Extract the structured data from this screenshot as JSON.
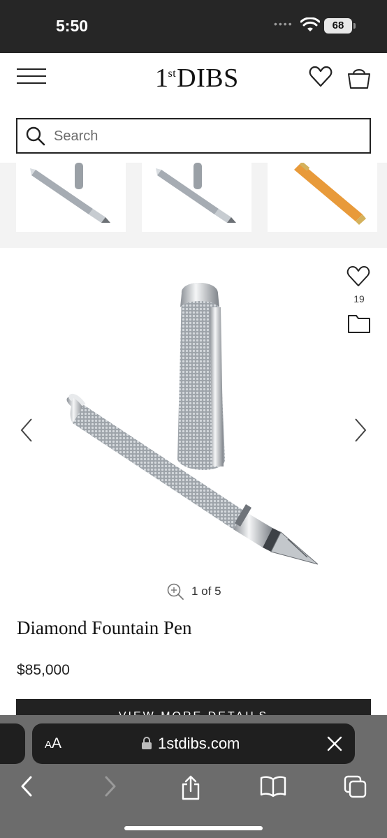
{
  "status_bar": {
    "time": "5:50",
    "battery": "68"
  },
  "header": {
    "logo_main": "1",
    "logo_sup": "st",
    "logo_rest": "DIBS"
  },
  "search": {
    "placeholder": "Search"
  },
  "product": {
    "favorite_count": "19",
    "image_counter": "1 of 5",
    "title": "Diamond Fountain Pen",
    "price": "$85,000",
    "details_button": "VIEW MORE DETAILS"
  },
  "browser": {
    "aa_label_small": "A",
    "aa_label_large": "A",
    "url": "1stdibs.com"
  },
  "icons": {
    "menu": "hamburger-menu-icon",
    "favorites": "heart-icon",
    "cart": "shopping-bag-icon",
    "search": "search-icon",
    "folder": "folder-icon",
    "zoom": "zoom-in-icon",
    "lock": "lock-icon",
    "close": "close-icon",
    "back": "chevron-left-icon",
    "forward": "chevron-right-icon",
    "share": "share-icon",
    "bookmarks": "book-icon",
    "tabs": "tabs-icon"
  }
}
